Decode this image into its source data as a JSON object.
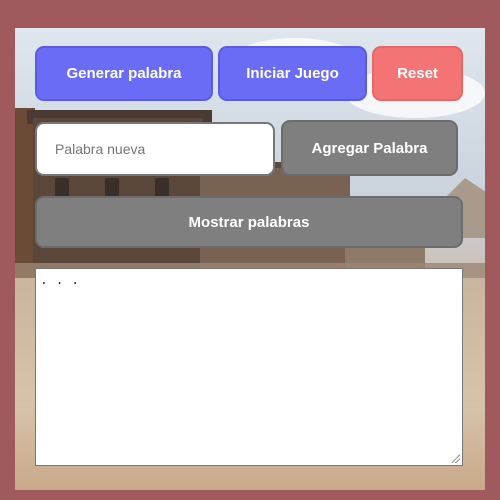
{
  "buttons": {
    "generate": "Generar palabra",
    "start": "Iniciar Juego",
    "reset": "Reset",
    "add_word": "Agregar Palabra",
    "show_words": "Mostrar palabras"
  },
  "new_word_input": {
    "placeholder": "Palabra nueva",
    "value": ""
  },
  "output": {
    "text": ". . ."
  },
  "colors": {
    "frame": "#a0595c",
    "primary": "#6a6cf5",
    "danger": "#f47475",
    "secondary": "#7f7f7f"
  }
}
